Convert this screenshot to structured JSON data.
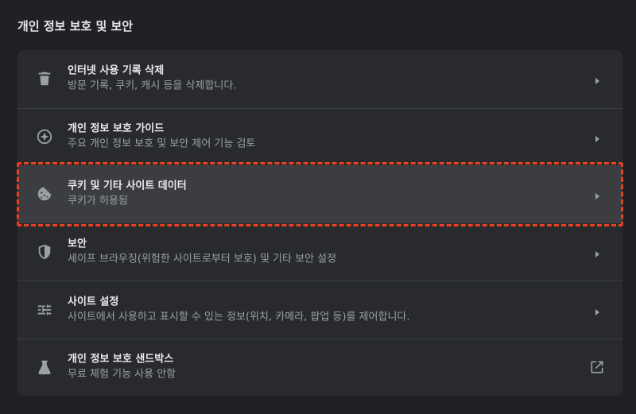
{
  "section": {
    "title": "개인 정보 보호 및 보안"
  },
  "rows": [
    {
      "title": "인터넷 사용 기록 삭제",
      "subtitle": "방문 기록, 쿠키, 캐시 등을 삭제합니다.",
      "icon": "trash-icon",
      "action": "chevron-right-icon"
    },
    {
      "title": "개인 정보 보호 가이드",
      "subtitle": "주요 개인 정보 보호 및 보안 제어 기능 검토",
      "icon": "compass-icon",
      "action": "chevron-right-icon"
    },
    {
      "title": "쿠키 및 기타 사이트 데이터",
      "subtitle": "쿠키가 허용됨",
      "icon": "cookie-icon",
      "action": "chevron-right-icon",
      "highlighted": true
    },
    {
      "title": "보안",
      "subtitle": "세이프 브라우징(위험한 사이트로부터 보호) 및 기타 보안 설정",
      "icon": "shield-icon",
      "action": "chevron-right-icon"
    },
    {
      "title": "사이트 설정",
      "subtitle": "사이트에서 사용하고 표시할 수 있는 정보(위치, 카메라, 팝업 등)를 제어합니다.",
      "icon": "tune-icon",
      "action": "chevron-right-icon"
    },
    {
      "title": "개인 정보 보호 샌드박스",
      "subtitle": "무료 체험 기능 사용 안함",
      "icon": "flask-icon",
      "action": "open-in-new-icon"
    }
  ],
  "colors": {
    "background": "#202124",
    "card": "#292a2d",
    "highlight_row": "#3c3d40",
    "annotation_border": "#e8421e"
  }
}
